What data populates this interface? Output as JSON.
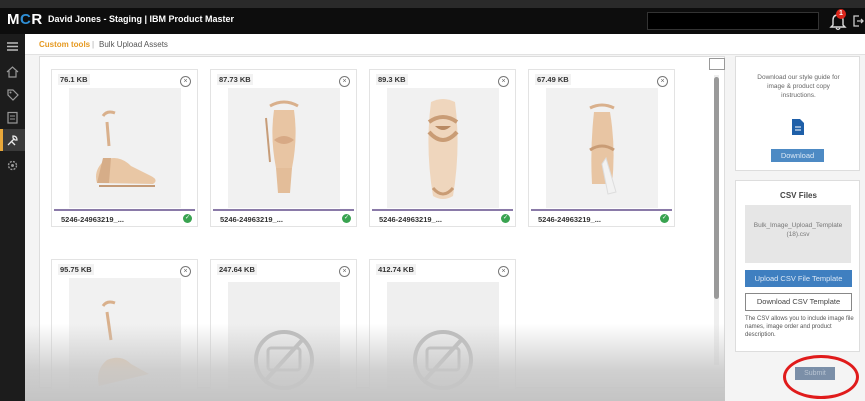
{
  "header": {
    "logo": {
      "m": "M",
      "o": "C",
      "r": "R"
    },
    "title": "David Jones - Staging | IBM Product Master",
    "notification_count": "1"
  },
  "sidebar": {
    "icons": [
      "menu-icon",
      "home-icon",
      "tag-icon",
      "clipboard-icon",
      "tools-icon",
      "settings-icon"
    ],
    "active_color": "#e9a83a"
  },
  "breadcrumb": {
    "items": [
      "Custom tools",
      "Bulk Upload Assets"
    ],
    "separator": "|"
  },
  "cards": [
    {
      "size": "76.1 KB",
      "name": "5246-24963219_...",
      "uploaded": true,
      "image": "wedge-sandal-side"
    },
    {
      "size": "87.73 KB",
      "name": "5246-24963219_...",
      "uploaded": true,
      "image": "sandal-front"
    },
    {
      "size": "89.3 KB",
      "name": "5246-24963219_...",
      "uploaded": true,
      "image": "sandal-top"
    },
    {
      "size": "67.49 KB",
      "name": "5246-24963219_...",
      "uploaded": true,
      "image": "sandal-back"
    },
    {
      "size": "95.75 KB",
      "name": "",
      "uploaded": false,
      "image": "wedge-sandal-side"
    },
    {
      "size": "247.64 KB",
      "name": "",
      "uploaded": false,
      "image": "no-image-icon"
    },
    {
      "size": "412.74 KB",
      "name": "",
      "uploaded": false,
      "image": "no-image-icon"
    }
  ],
  "style_guide": {
    "text": "Download our style guide for image & product copy instructions.",
    "download_label": "Download"
  },
  "csv": {
    "title": "CSV Files",
    "file_name": "Bulk_Image_Upload_Template (18).csv",
    "upload_label": "Upload CSV File Template",
    "download_label": "Download CSV Template",
    "note": "The CSV allows you to include image file names, image order and product description."
  },
  "footer": {
    "submit_label": "Submit"
  },
  "colors": {
    "accent": "#e69a22",
    "primary_button": "#3f7fc0",
    "success": "#39a350",
    "highlight_circle": "#e01b1b"
  }
}
